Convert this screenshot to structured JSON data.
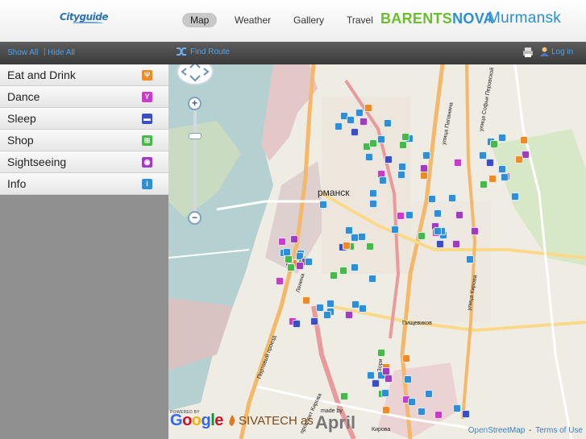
{
  "header": {
    "logo_city": "City",
    "logo_guide": "guide",
    "nav": [
      {
        "label": "Map",
        "active": true
      },
      {
        "label": "Weather",
        "active": false
      },
      {
        "label": "Gallery",
        "active": false
      },
      {
        "label": "Travel",
        "active": false
      }
    ],
    "brand_part1": "BARENTS",
    "brand_part2": "NOVA",
    "brand_city": "Murmansk"
  },
  "toolbar": {
    "show_all": "Show All",
    "separator": "|",
    "hide_all": "Hide All",
    "find_route": "Find Route",
    "find_route_icon": "route-icon",
    "print_icon": "printer-icon",
    "login": "Log in",
    "login_icon": "user-icon"
  },
  "sidebar": {
    "categories": [
      {
        "label": "Eat and Drink",
        "icon": "cutlery-icon",
        "glyph": "🍴",
        "color": "#f08a24"
      },
      {
        "label": "Dance",
        "icon": "cocktail-icon",
        "glyph": "Y",
        "color": "#c93cc9"
      },
      {
        "label": "Sleep",
        "icon": "bed-icon",
        "glyph": "▬",
        "color": "#3a4fc4"
      },
      {
        "label": "Shop",
        "icon": "cart-icon",
        "glyph": "⊞",
        "color": "#47b84a"
      },
      {
        "label": "Sightseeing",
        "icon": "camera-icon",
        "glyph": "◉",
        "color": "#a03cc0"
      },
      {
        "label": "Info",
        "icon": "info-icon",
        "glyph": "i",
        "color": "#2e8fd8"
      }
    ]
  },
  "map": {
    "city_label": "рманск",
    "street_labels": [
      "Портовый проезд",
      "Ленина",
      "проспект Кирова",
      "Кирова",
      "улица Папанина",
      "улица Софьи Перовской",
      "улица Кирова",
      "Зори",
      "Пищевиков"
    ],
    "powered_by": "POWERED BY",
    "google": "Google",
    "sivatech": "SIVATECH as",
    "made_by": "made by",
    "april": "April",
    "attribution_osm": "OpenStreetMap",
    "attribution_sep": "-",
    "attribution_terms": "Terms of Use",
    "zoom_in": "+",
    "zoom_out": "−",
    "marker_colors": {
      "info": "#2e8fd8",
      "food": "#f08a24",
      "sight": "#a03cc0",
      "shop": "#47b84a",
      "sleep": "#3a4fc4",
      "dance": "#c93cc9"
    }
  }
}
